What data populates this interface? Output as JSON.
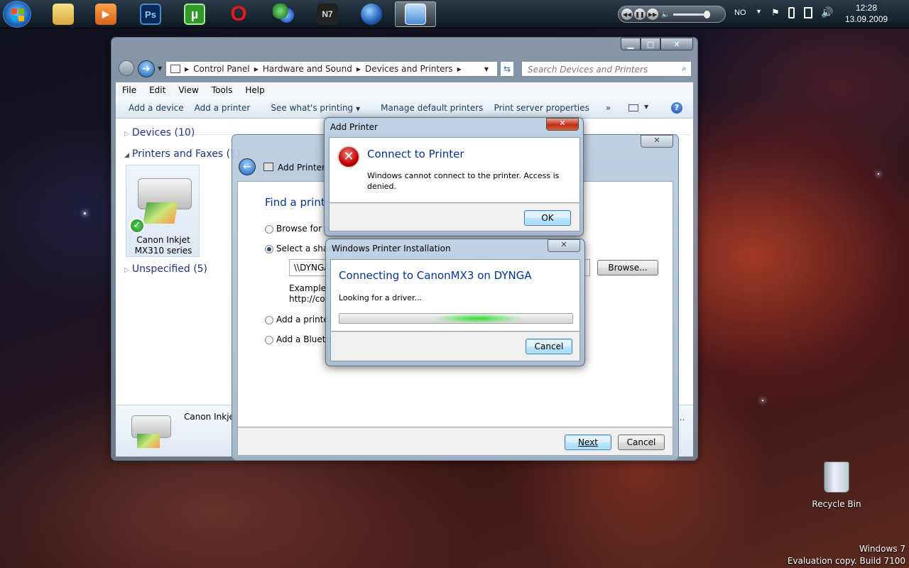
{
  "taskbar": {
    "apps": [
      {
        "name": "folder",
        "label": ""
      },
      {
        "name": "media-player",
        "label": ""
      },
      {
        "name": "photoshop",
        "label": "Ps"
      },
      {
        "name": "utorrent",
        "label": "µ"
      },
      {
        "name": "opera",
        "label": "O"
      },
      {
        "name": "messenger",
        "label": ""
      },
      {
        "name": "n7",
        "label": "N7"
      },
      {
        "name": "google-earth",
        "label": ""
      },
      {
        "name": "control-panel",
        "label": ""
      }
    ],
    "language": "NO",
    "clock_time": "12:28",
    "clock_date": "13.09.2009"
  },
  "explorer": {
    "breadcrumb": [
      "Control Panel",
      "Hardware and Sound",
      "Devices and Printers"
    ],
    "search_placeholder": "Search Devices and Printers",
    "menu": [
      "File",
      "Edit",
      "View",
      "Tools",
      "Help"
    ],
    "commands": [
      "Add a device",
      "Add a printer",
      "See what's printing",
      "Manage default printers",
      "Print server properties"
    ],
    "overflow": "»",
    "groups": {
      "devices": "Devices (10)",
      "printers": "Printers and Faxes (1)",
      "unspecified": "Unspecified (5)"
    },
    "printer_name_line1": "Canon Inkjet",
    "printer_name_line2": "MX310 series",
    "detail_name": "Canon Inkje",
    "detail_ellipsis": "..."
  },
  "wizard": {
    "title": "Add Printer",
    "heading": "Find a printe",
    "option_browse": "Browse for a",
    "option_select": "Select a share",
    "share_value": "\\\\DYNGA",
    "browse_button": "Browse...",
    "example_line1": "Example: \\",
    "example_line2": "http://co",
    "option_tcp": "Add a printer",
    "option_bluetooth": "Add a Blueto",
    "next_button": "Next",
    "cancel_button": "Cancel"
  },
  "error_dialog": {
    "title": "Add Printer",
    "heading": "Connect to Printer",
    "message_line1": "Windows cannot connect to the printer.  Access is",
    "message_line2": "denied.",
    "ok_button": "OK"
  },
  "install_dialog": {
    "title": "Windows Printer Installation",
    "heading": "Connecting to CanonMX3 on DYNGA",
    "status": "Looking for a driver...",
    "cancel_button": "Cancel"
  },
  "desktop": {
    "recycle_bin": "Recycle Bin",
    "watermark_line1": "Windows 7",
    "watermark_line2": "Evaluation copy. Build 7100"
  }
}
